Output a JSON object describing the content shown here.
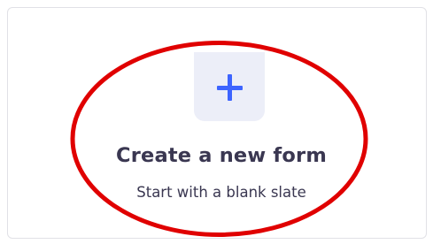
{
  "card": {
    "icon": "plus-icon",
    "title": "Create a new form",
    "subtitle": "Start with a blank slate"
  },
  "colors": {
    "accent": "#3d64ff",
    "icon_tile_bg": "#eceef8",
    "text": "#3a3751",
    "annotation": "#e00000"
  }
}
